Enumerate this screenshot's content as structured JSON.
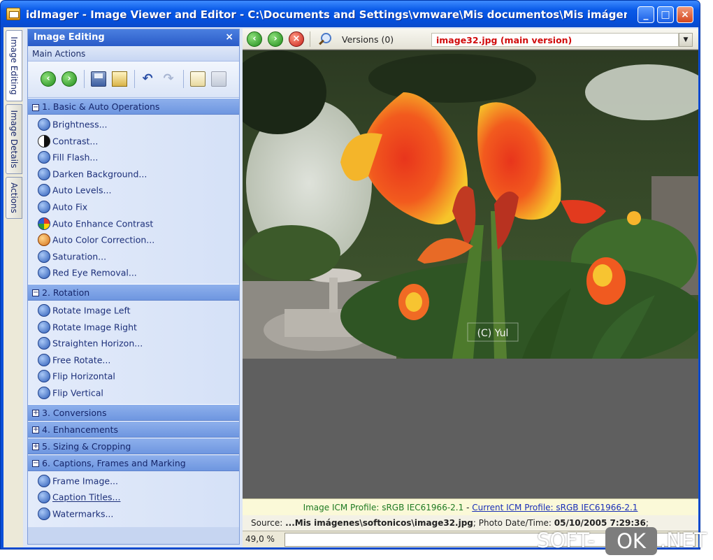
{
  "window": {
    "title": "idImager - Image Viewer and Editor - C:\\Documents and Settings\\vmware\\Mis documentos\\Mis imágenes\\s...",
    "min_glyph": "_",
    "max_glyph": "□",
    "close_glyph": "×"
  },
  "vtabs": [
    "Image Editing",
    "Image Details",
    "Actions"
  ],
  "panel": {
    "title": "Image Editing",
    "close_glyph": "×",
    "main_actions": "Main Actions",
    "groups": [
      {
        "label": "1. Basic & Auto Operations",
        "expanded": true,
        "items": [
          "Brightness...",
          "Contrast...",
          "Fill Flash...",
          "Darken Background...",
          "Auto Levels...",
          "Auto Fix",
          "Auto Enhance Contrast",
          "Auto Color Correction...",
          "Saturation...",
          "Red Eye Removal..."
        ]
      },
      {
        "label": "2. Rotation",
        "expanded": true,
        "items": [
          "Rotate Image Left",
          "Rotate Image Right",
          "Straighten Horizon...",
          "Free Rotate...",
          "Flip Horizontal",
          "Flip Vertical"
        ]
      },
      {
        "label": "3. Conversions",
        "expanded": false
      },
      {
        "label": "4. Enhancements",
        "expanded": false
      },
      {
        "label": "5. Sizing & Cropping",
        "expanded": false
      },
      {
        "label": "6. Captions, Frames and Marking",
        "expanded": true,
        "items": [
          "Frame Image...",
          "Caption Titles...",
          "Watermarks..."
        ]
      }
    ]
  },
  "viewer": {
    "versions_label": "Versions (0)",
    "version_name": "image32.jpg (main version)",
    "photo_caption": "(C) Yul",
    "icm_image": "Image ICM Profile: sRGB IEC61966-2.1",
    "icm_sep": "-",
    "icm_current": "Current ICM Profile: sRGB IEC61966-2.1",
    "source_label": "Source: ",
    "source_path": "...Mis imágenes\\softonicos\\image32.jpg",
    "date_label": "; Photo Date/Time: ",
    "date_value": "05/10/2005 7:29:36",
    "date_tail": ";",
    "zoom": "49,0 %"
  },
  "watermark": {
    "pre": "SOFT-",
    "ok": "OK",
    "post": ".NET"
  },
  "colors": {
    "title_blue": "#0a4fd8",
    "version_red": "#d10c0c",
    "icm_green": "#1e7a22"
  }
}
